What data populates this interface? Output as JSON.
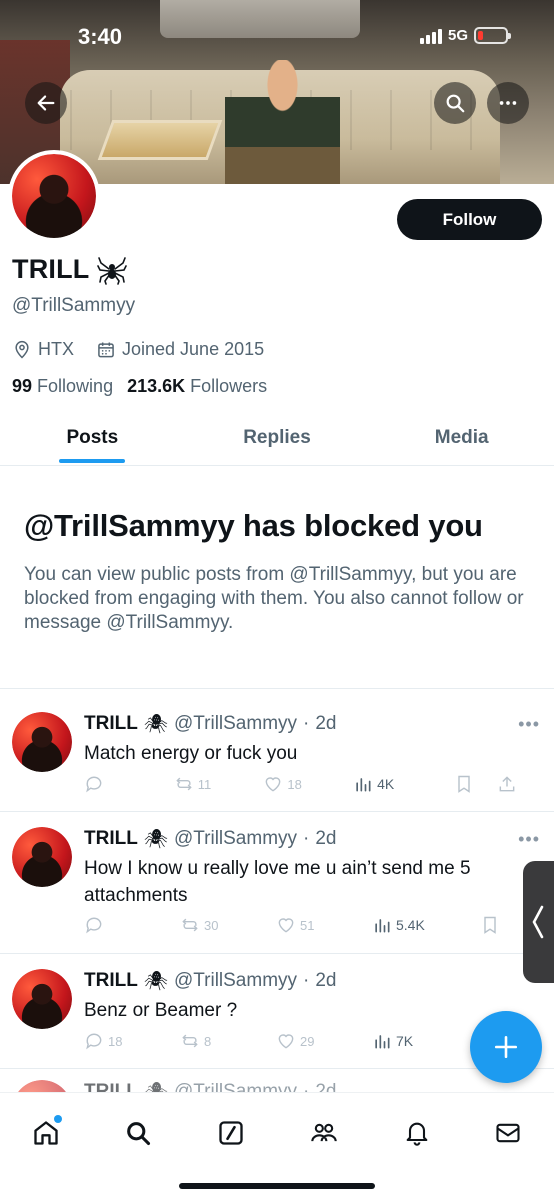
{
  "status_bar": {
    "time": "3:40",
    "network": "5G"
  },
  "profile": {
    "display_name": "TRILL",
    "handle": "@TrillSammyy",
    "location": "HTX",
    "joined": "Joined June 2015",
    "following_count": "99",
    "following_label": "Following",
    "followers_count": "213.6K",
    "followers_label": "Followers",
    "follow_label": "Follow"
  },
  "tabs": [
    {
      "label": "Posts",
      "active": true
    },
    {
      "label": "Replies",
      "active": false
    },
    {
      "label": "Media",
      "active": false
    }
  ],
  "blocked": {
    "title": "@TrillSammyy has blocked you",
    "message": "You can view public posts from @TrillSammyy, but you are blocked from engaging with them. You also cannot follow or message @TrillSammyy."
  },
  "posts": [
    {
      "name": "TRILL",
      "handle": "@TrillSammyy",
      "time": "2d",
      "text": "Match energy or fuck you",
      "replies": "",
      "reposts": "11",
      "likes": "18",
      "views": "4K"
    },
    {
      "name": "TRILL",
      "handle": "@TrillSammyy",
      "time": "2d",
      "text": "How I know u really love me u ain’t send me 5 attachments",
      "replies": "",
      "reposts": "30",
      "likes": "51",
      "views": "5.4K"
    },
    {
      "name": "TRILL",
      "handle": "@TrillSammyy",
      "time": "2d",
      "text": "Benz or Beamer ?",
      "replies": "18",
      "reposts": "8",
      "likes": "29",
      "views": "7K"
    }
  ],
  "partial_post": {
    "name": "TRILL",
    "handle": "@TrillSammyy",
    "time": "2d"
  },
  "icons": {
    "back": "arrow-left-icon",
    "search": "search-icon",
    "more": "more-icon",
    "location": "location-pin-icon",
    "calendar": "calendar-icon",
    "nav": [
      "home-icon",
      "search-icon",
      "grok-icon",
      "communities-icon",
      "notifications-icon",
      "messages-icon"
    ]
  },
  "colors": {
    "accent": "#1d9bf0",
    "text": "#0f1419",
    "muted": "#536471"
  }
}
